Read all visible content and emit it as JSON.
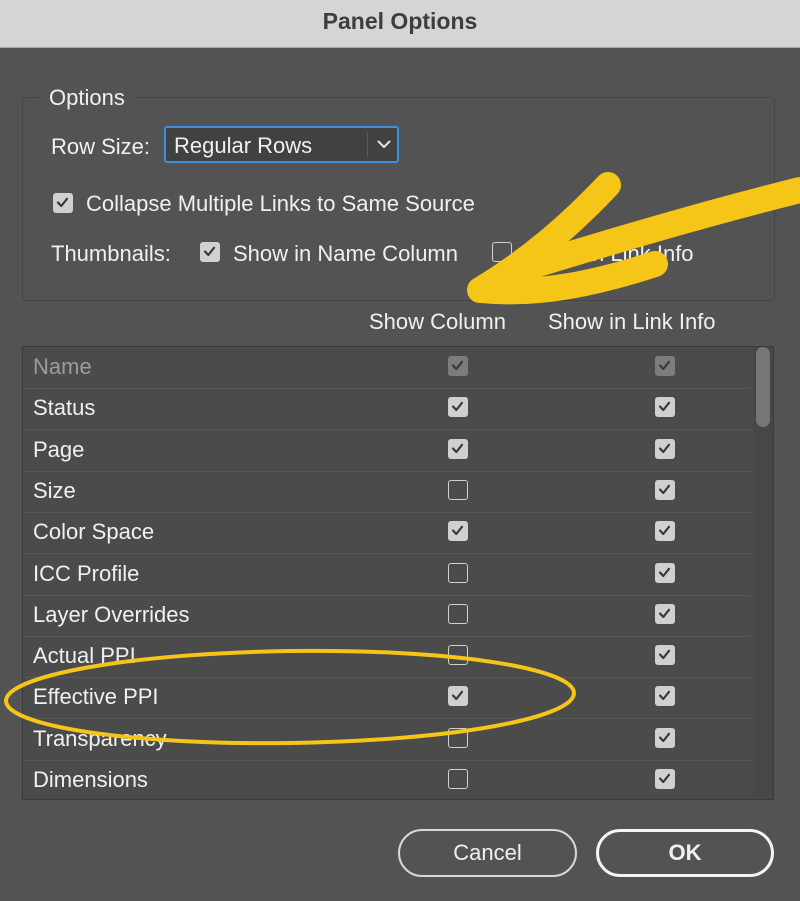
{
  "window": {
    "title": "Panel Options"
  },
  "options": {
    "legend": "Options",
    "row_size_label": "Row Size:",
    "row_size_value": "Regular Rows",
    "collapse_label": "Collapse Multiple Links to Same Source",
    "collapse_checked": true,
    "thumbnails_label": "Thumbnails:",
    "thumb_name_label": "Show in Name Column",
    "thumb_name_checked": true,
    "thumb_link_label": "Show in Link Info",
    "thumb_link_checked": false
  },
  "table": {
    "col_show": "Show Column",
    "col_link": "Show in Link Info",
    "rows": [
      {
        "name": "Name",
        "show": true,
        "link": true,
        "disabled": true
      },
      {
        "name": "Status",
        "show": true,
        "link": true,
        "disabled": false
      },
      {
        "name": "Page",
        "show": true,
        "link": true,
        "disabled": false
      },
      {
        "name": "Size",
        "show": false,
        "link": true,
        "disabled": false
      },
      {
        "name": "Color Space",
        "show": true,
        "link": true,
        "disabled": false
      },
      {
        "name": "ICC Profile",
        "show": false,
        "link": true,
        "disabled": false
      },
      {
        "name": "Layer Overrides",
        "show": false,
        "link": true,
        "disabled": false
      },
      {
        "name": "Actual PPI",
        "show": false,
        "link": true,
        "disabled": false
      },
      {
        "name": "Effective PPI",
        "show": true,
        "link": true,
        "disabled": false
      },
      {
        "name": "Transparency",
        "show": false,
        "link": true,
        "disabled": false
      },
      {
        "name": "Dimensions",
        "show": false,
        "link": true,
        "disabled": false
      }
    ]
  },
  "buttons": {
    "cancel": "Cancel",
    "ok": "OK"
  },
  "colors": {
    "annotation": "#f5c518",
    "focus_ring": "#3e8fe0",
    "dialog_bg": "#535353"
  }
}
